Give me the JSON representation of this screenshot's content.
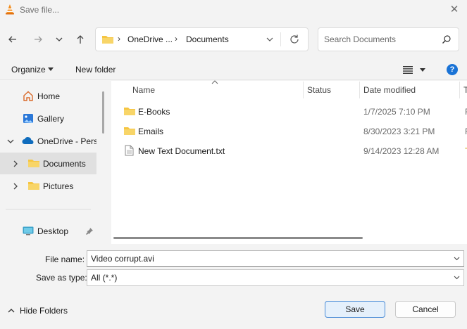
{
  "window": {
    "title": "Save file..."
  },
  "address": {
    "crumbs": [
      "OneDrive ...",
      "Documents"
    ]
  },
  "search": {
    "placeholder": "Search Documents"
  },
  "toolbar": {
    "organize_label": "Organize",
    "new_folder_label": "New folder",
    "help_glyph": "?"
  },
  "nav": {
    "items": [
      {
        "label": "Home",
        "icon": "home-icon"
      },
      {
        "label": "Gallery",
        "icon": "gallery-icon"
      },
      {
        "label": "OneDrive - Perso",
        "icon": "cloud-icon"
      },
      {
        "label": "Documents",
        "icon": "folder-icon"
      },
      {
        "label": "Pictures",
        "icon": "folder-icon"
      },
      {
        "label": "Desktop",
        "icon": "desktop-icon"
      }
    ]
  },
  "columns": {
    "name": "Name",
    "status": "Status",
    "date": "Date modified",
    "type": "T"
  },
  "files": [
    {
      "name": "E-Books",
      "date": "1/7/2025 7:10 PM",
      "type": "F",
      "icon": "folder-icon"
    },
    {
      "name": "Emails",
      "date": "8/30/2023 3:21 PM",
      "type": "F",
      "icon": "folder-icon"
    },
    {
      "name": "New Text Document.txt",
      "date": "9/14/2023 12:28 AM",
      "type": "T",
      "icon": "text-file-icon"
    }
  ],
  "form": {
    "file_name_label": "File name:",
    "file_name_value": "Video corrupt.avi",
    "save_type_label": "Save as type:",
    "save_type_value": "All (*.*)"
  },
  "footer": {
    "hide_folders_label": "Hide Folders",
    "save_label": "Save",
    "cancel_label": "Cancel"
  },
  "colors": {
    "accent": "#1a73d6",
    "folder": "#f5c542",
    "selected_bg": "#e0e0e0"
  }
}
